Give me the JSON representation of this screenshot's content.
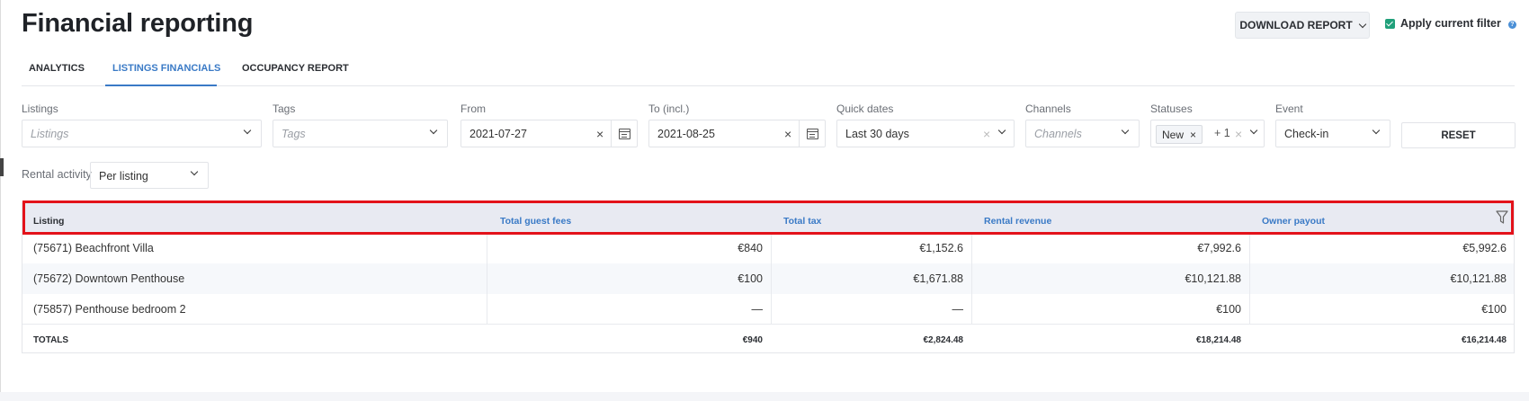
{
  "header": {
    "title": "Financial reporting",
    "download_label": "DOWNLOAD REPORT",
    "apply_filter_label": "Apply current filter",
    "apply_filter_checked": true,
    "help_glyph": "?"
  },
  "tabs": [
    {
      "label": "ANALYTICS",
      "active": false
    },
    {
      "label": "LISTINGS FINANCIALS",
      "active": true
    },
    {
      "label": "OCCUPANCY REPORT",
      "active": false
    }
  ],
  "filters": {
    "listings": {
      "label": "Listings",
      "placeholder": "Listings"
    },
    "tags": {
      "label": "Tags",
      "placeholder": "Tags"
    },
    "from": {
      "label": "From",
      "value": "2021-07-27"
    },
    "to": {
      "label": "To (incl.)",
      "value": "2021-08-25"
    },
    "quick_dates": {
      "label": "Quick dates",
      "value": "Last 30 days"
    },
    "channels": {
      "label": "Channels",
      "placeholder": "Channels"
    },
    "statuses": {
      "label": "Statuses",
      "chip": "New",
      "more": "+ 1"
    },
    "event": {
      "label": "Event",
      "value": "Check-in"
    },
    "reset_label": "RESET",
    "clear_glyph": "×"
  },
  "rental_activity": {
    "label": "Rental activity",
    "value": "Per listing"
  },
  "table": {
    "columns": [
      "Listing",
      "Total guest fees",
      "Total tax",
      "Rental revenue",
      "Owner payout"
    ],
    "rows": [
      [
        "(75671) Beachfront Villa",
        "€840",
        "€1,152.6",
        "€7,992.6",
        "€5,992.6"
      ],
      [
        "(75672) Downtown Penthouse",
        "€100",
        "€1,671.88",
        "€10,121.88",
        "€10,121.88"
      ],
      [
        "(75857) Penthouse bedroom 2",
        "—",
        "—",
        "€100",
        "€100"
      ]
    ],
    "totals": [
      "TOTALS",
      "€940",
      "€2,824.48",
      "€18,214.48",
      "€16,214.48"
    ]
  },
  "colors": {
    "accent": "#3a7ac6",
    "check": "#20a07a",
    "highlight": "#e3121a",
    "header_bg": "#e8eaf2"
  },
  "icons": [
    "chevron-down-icon",
    "calendar-icon",
    "close-icon",
    "filter-icon",
    "help-icon",
    "checkbox-icon"
  ]
}
